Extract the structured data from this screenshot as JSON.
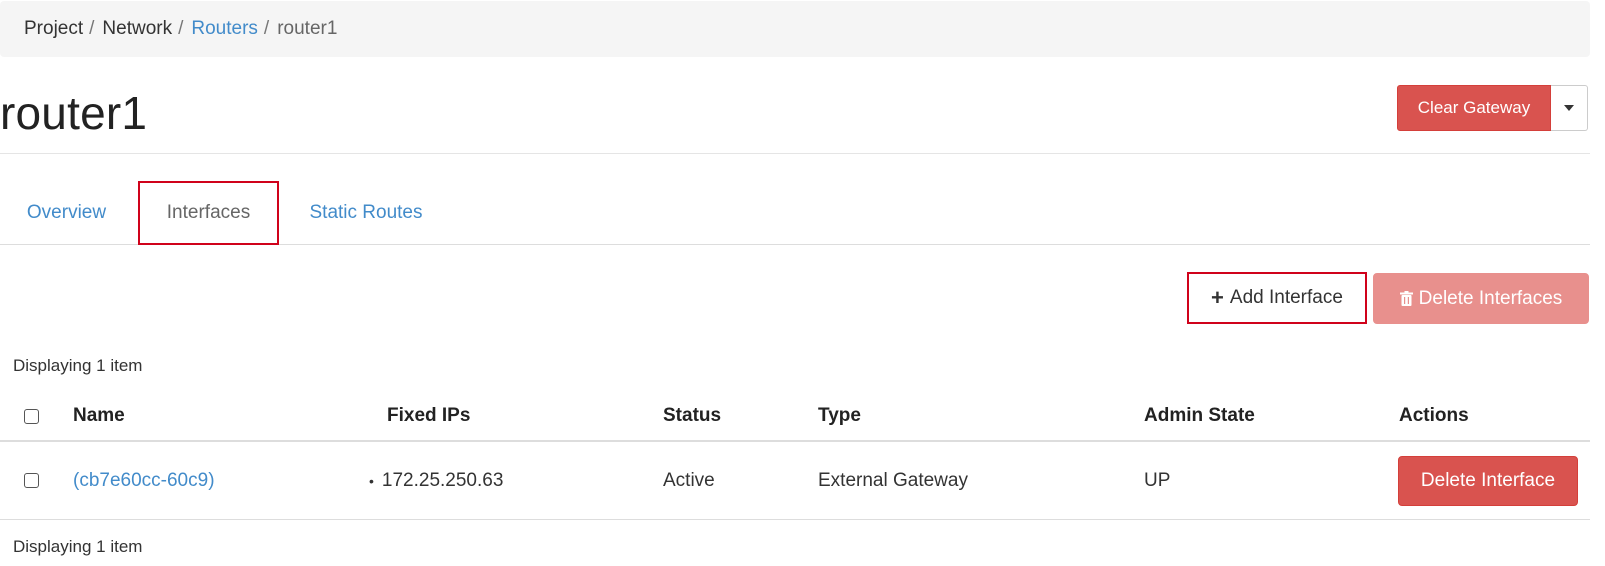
{
  "breadcrumb": {
    "items": [
      {
        "label": "Project"
      },
      {
        "label": "Network"
      },
      {
        "label": "Routers"
      },
      {
        "label": "router1"
      }
    ],
    "separator": "/"
  },
  "page": {
    "title": "router1"
  },
  "header_actions": {
    "clear_gateway_label": "Clear Gateway",
    "more_icon": "caret-down-icon"
  },
  "tabs": [
    {
      "label": "Overview",
      "active": false
    },
    {
      "label": "Interfaces",
      "active": true
    },
    {
      "label": "Static Routes",
      "active": false
    }
  ],
  "table_actions": {
    "add_interface_label": "Add Interface",
    "add_icon": "plus-icon",
    "delete_interfaces_label": "Delete Interfaces",
    "delete_icon": "trash-icon"
  },
  "table": {
    "count_top": "Displaying 1 item",
    "count_bottom": "Displaying 1 item",
    "columns": [
      "Name",
      "Fixed IPs",
      "Status",
      "Type",
      "Admin State",
      "Actions"
    ],
    "rows": [
      {
        "name": "(cb7e60cc-60c9)",
        "fixed_ip": "172.25.250.63",
        "status": "Active",
        "type": "External Gateway",
        "admin_state": "UP",
        "action_label": "Delete Interface"
      }
    ]
  },
  "colors": {
    "link": "#428bca",
    "danger": "#d9534f",
    "danger_disabled": "#e8908d",
    "highlight_border": "#d0021b"
  }
}
